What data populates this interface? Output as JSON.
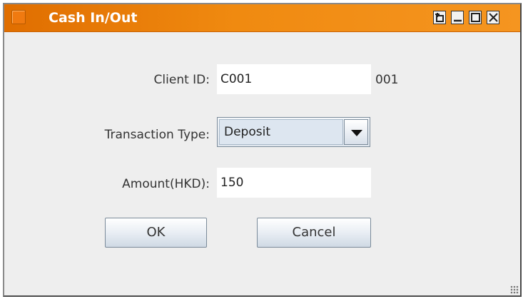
{
  "window": {
    "title": "Cash In/Out",
    "title_buttons": [
      "pin-icon",
      "minimize-icon",
      "maximize-icon",
      "close-icon"
    ]
  },
  "form": {
    "client_id": {
      "label": "Client ID:",
      "value": "C001",
      "suffix": "001"
    },
    "transaction_type": {
      "label": "Transaction Type:",
      "selected": "Deposit"
    },
    "amount": {
      "label": "Amount(HKD):",
      "value": "150"
    }
  },
  "buttons": {
    "ok_label": "OK",
    "cancel_label": "Cancel"
  },
  "colors": {
    "titlebar": "#f08a10",
    "background": "#eeeeee"
  }
}
